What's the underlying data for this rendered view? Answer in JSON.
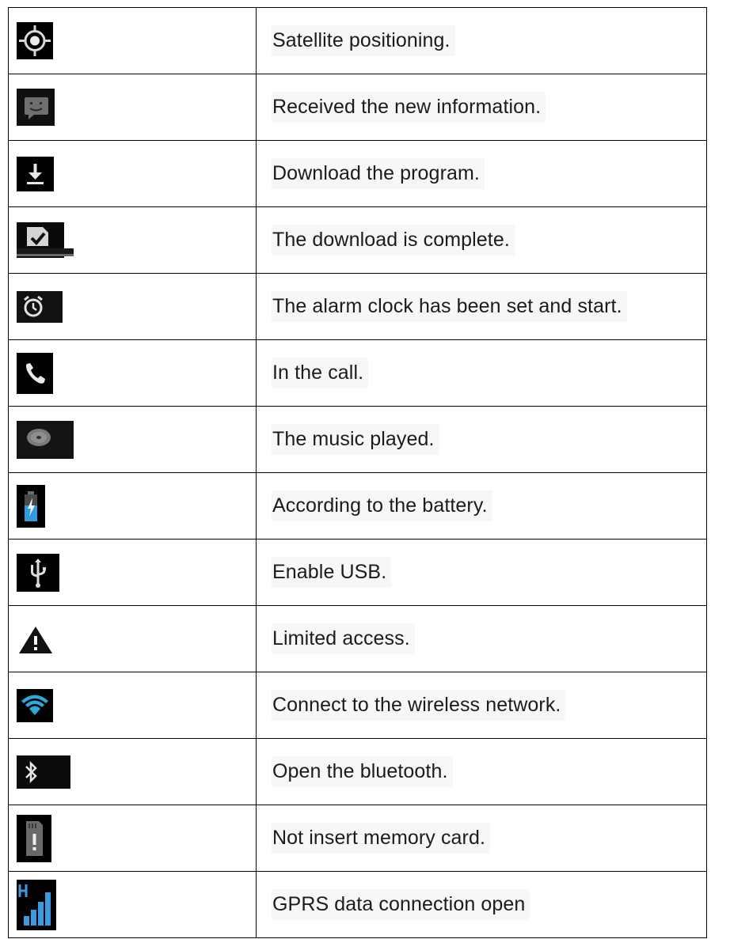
{
  "rows": [
    {
      "icon": "satellite-positioning-icon",
      "text": "Satellite positioning."
    },
    {
      "icon": "message-icon",
      "text": "Received the new information."
    },
    {
      "icon": "download-icon",
      "text": "Download the program."
    },
    {
      "icon": "download-complete-icon",
      "text": "The download is complete."
    },
    {
      "icon": "alarm-clock-icon",
      "text": "The alarm clock has been set and start."
    },
    {
      "icon": "phone-call-icon",
      "text": "In the call."
    },
    {
      "icon": "music-disc-icon",
      "text": "The music played."
    },
    {
      "icon": "battery-charging-icon",
      "text": "According to the battery."
    },
    {
      "icon": "usb-icon",
      "text": "Enable USB."
    },
    {
      "icon": "warning-icon",
      "text": "Limited access."
    },
    {
      "icon": "wifi-icon",
      "text": "Connect to the wireless network."
    },
    {
      "icon": "bluetooth-icon",
      "text": "Open the bluetooth."
    },
    {
      "icon": "no-memory-card-icon",
      "text": "Not insert memory card."
    },
    {
      "icon": "hspa-signal-icon",
      "text": "GPRS data connection open"
    }
  ],
  "colors": {
    "icon_background": "#000000",
    "wifi_blue": "#2ea8d8",
    "signal_blue": "#3b9be0",
    "battery_blue": "#2f9be0",
    "text": "#1b1b1b",
    "text_background": "#f7f7f7"
  }
}
